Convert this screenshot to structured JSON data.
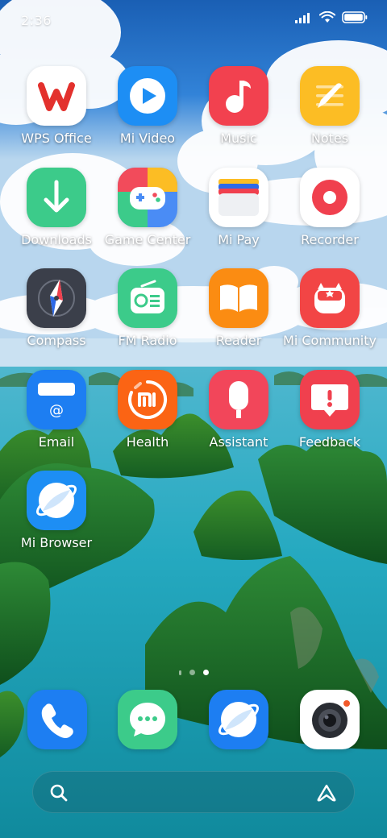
{
  "status_bar": {
    "time": "2:36"
  },
  "apps": [
    {
      "label": "WPS Office",
      "icon": "wps-office-icon",
      "color": "#ffffff"
    },
    {
      "label": "Mi Video",
      "icon": "mi-video-icon",
      "color": "#1d8ef4"
    },
    {
      "label": "Music",
      "icon": "music-icon",
      "color": "#f2414f"
    },
    {
      "label": "Notes",
      "icon": "notes-icon",
      "color": "#fcbd24"
    },
    {
      "label": "Downloads",
      "icon": "downloads-icon",
      "color": "#3ccb8a"
    },
    {
      "label": "Game Center",
      "icon": "game-center-icon",
      "color": "#4a8cf5"
    },
    {
      "label": "Mi Pay",
      "icon": "mi-pay-icon",
      "color": "#ffffff"
    },
    {
      "label": "Recorder",
      "icon": "recorder-icon",
      "color": "#ffffff"
    },
    {
      "label": "Compass",
      "icon": "compass-icon",
      "color": "#3b3f4a"
    },
    {
      "label": "FM Radio",
      "icon": "fm-radio-icon",
      "color": "#3ccb8a"
    },
    {
      "label": "Reader",
      "icon": "reader-icon",
      "color": "#fb8c12"
    },
    {
      "label": "Mi Community",
      "icon": "mi-community-icon",
      "color": "#f24545"
    },
    {
      "label": "Email",
      "icon": "email-icon",
      "color": "#1d7ef2"
    },
    {
      "label": "Health",
      "icon": "health-icon",
      "color": "#fb6414"
    },
    {
      "label": "Assistant",
      "icon": "assistant-icon",
      "color": "#f2465a"
    },
    {
      "label": "Feedback",
      "icon": "feedback-icon",
      "color": "#f0404e"
    },
    {
      "label": "Mi Browser",
      "icon": "mi-browser-icon",
      "color": "#1d8ef4"
    }
  ],
  "dock": [
    {
      "icon": "phone-icon",
      "color": "#1d7ef2"
    },
    {
      "icon": "messages-icon",
      "color": "#3ccb8a"
    },
    {
      "icon": "browser-icon",
      "color": "#1d7ef2"
    },
    {
      "icon": "camera-icon",
      "color": "#ffffff"
    }
  ],
  "page_indicator": {
    "pages": 2,
    "active": 2
  }
}
